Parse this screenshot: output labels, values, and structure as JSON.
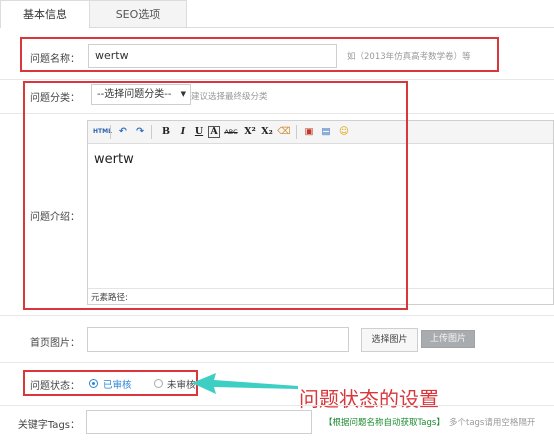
{
  "tabs": [
    {
      "label": "基本信息"
    },
    {
      "label": "SEO选项"
    }
  ],
  "title_row": {
    "label": "问题名称：",
    "value": "wertw",
    "hint": "如（2013年仿真高考数学卷）等"
  },
  "category_row": {
    "label": "问题分类：",
    "select_value": "--选择问题分类--",
    "hint": "建议选择最终级分类"
  },
  "intro_row": {
    "label": "问题介绍：",
    "editor_content": "wertw",
    "element_path": "元素路径:",
    "toolbar": {
      "html": "HTML",
      "undo": "↶",
      "redo": "↷",
      "bold": "B",
      "italic": "I",
      "underline": "U",
      "font_color": "A",
      "strikethrough": "ABC",
      "superscript": "X²",
      "subscript": "X₂",
      "eraser": "⌫",
      "image": "▣",
      "insert": "▤",
      "emoji": "☺"
    }
  },
  "cover_row": {
    "label": "首页图片：",
    "select_button": "选择图片",
    "upload_button": "上传图片"
  },
  "status_row": {
    "label": "问题状态：",
    "options": [
      {
        "label": "已审核",
        "checked": true
      },
      {
        "label": "未审核",
        "checked": false
      }
    ]
  },
  "annotation": {
    "text": "问题状态的设置",
    "color": "#d9373b",
    "arrow_color": "#3ecfc4"
  },
  "tags_row": {
    "label": "关键字Tags：",
    "auto_link": "【根据问题名称自动获取Tags】",
    "hint": "多个tags请用空格隔开"
  },
  "colors": {
    "highlight_red": "#d9373b",
    "radio_blue": "#2a86d8",
    "link_green": "#1a8a2e"
  }
}
